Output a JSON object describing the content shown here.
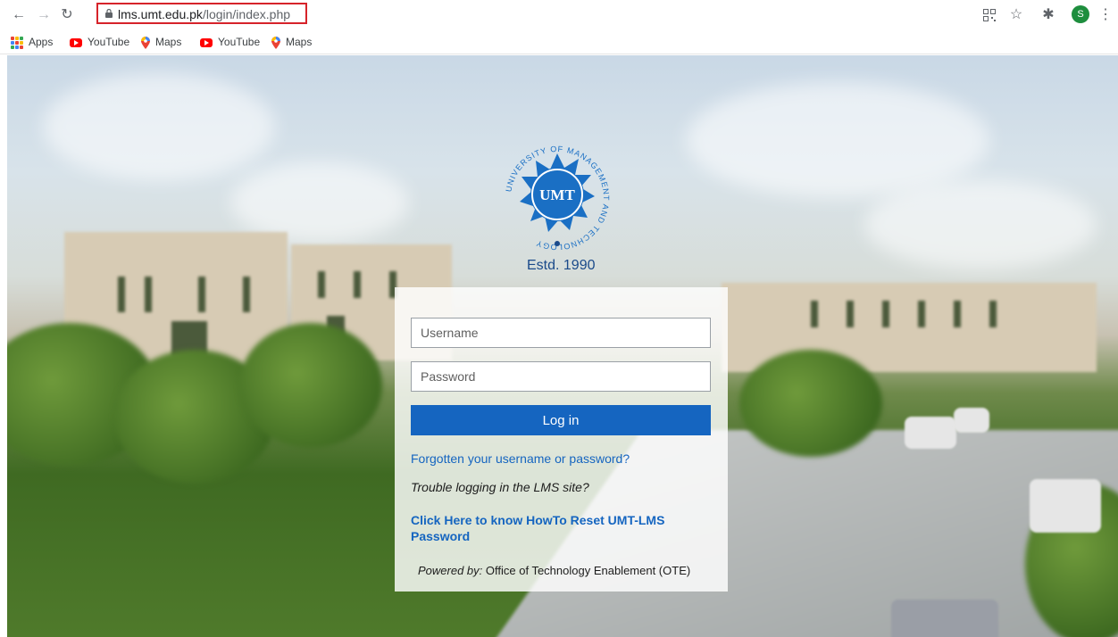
{
  "browser": {
    "url_host": "lms.umt.edu.pk",
    "url_path": "/login/index.php",
    "profile_initial": "S"
  },
  "bookmarks": [
    {
      "label": "Apps",
      "icon": "apps-grid-icon"
    },
    {
      "label": "YouTube",
      "icon": "youtube-icon"
    },
    {
      "label": "Maps",
      "icon": "maps-icon"
    },
    {
      "label": "YouTube",
      "icon": "youtube-icon"
    },
    {
      "label": "Maps",
      "icon": "maps-icon"
    }
  ],
  "logo": {
    "text": "UMT",
    "ring_text": "UNIVERSITY OF MANAGEMENT AND TECHNOLOGY",
    "estd": "Estd. 1990"
  },
  "login": {
    "username_placeholder": "Username",
    "password_placeholder": "Password",
    "login_label": "Log in",
    "forgot_link": "Forgotten your username or password?",
    "trouble_text": "Trouble logging in the LMS site?",
    "reset_link": "Click Here to know HowTo Reset UMT-LMS Password",
    "powered_prefix": "Powered by:",
    "powered_by": "Office of Technology Enablement (OTE)"
  },
  "colors": {
    "primary": "#1565c0",
    "url_highlight": "#d6232a",
    "logo_blue": "#1a6fc4"
  }
}
